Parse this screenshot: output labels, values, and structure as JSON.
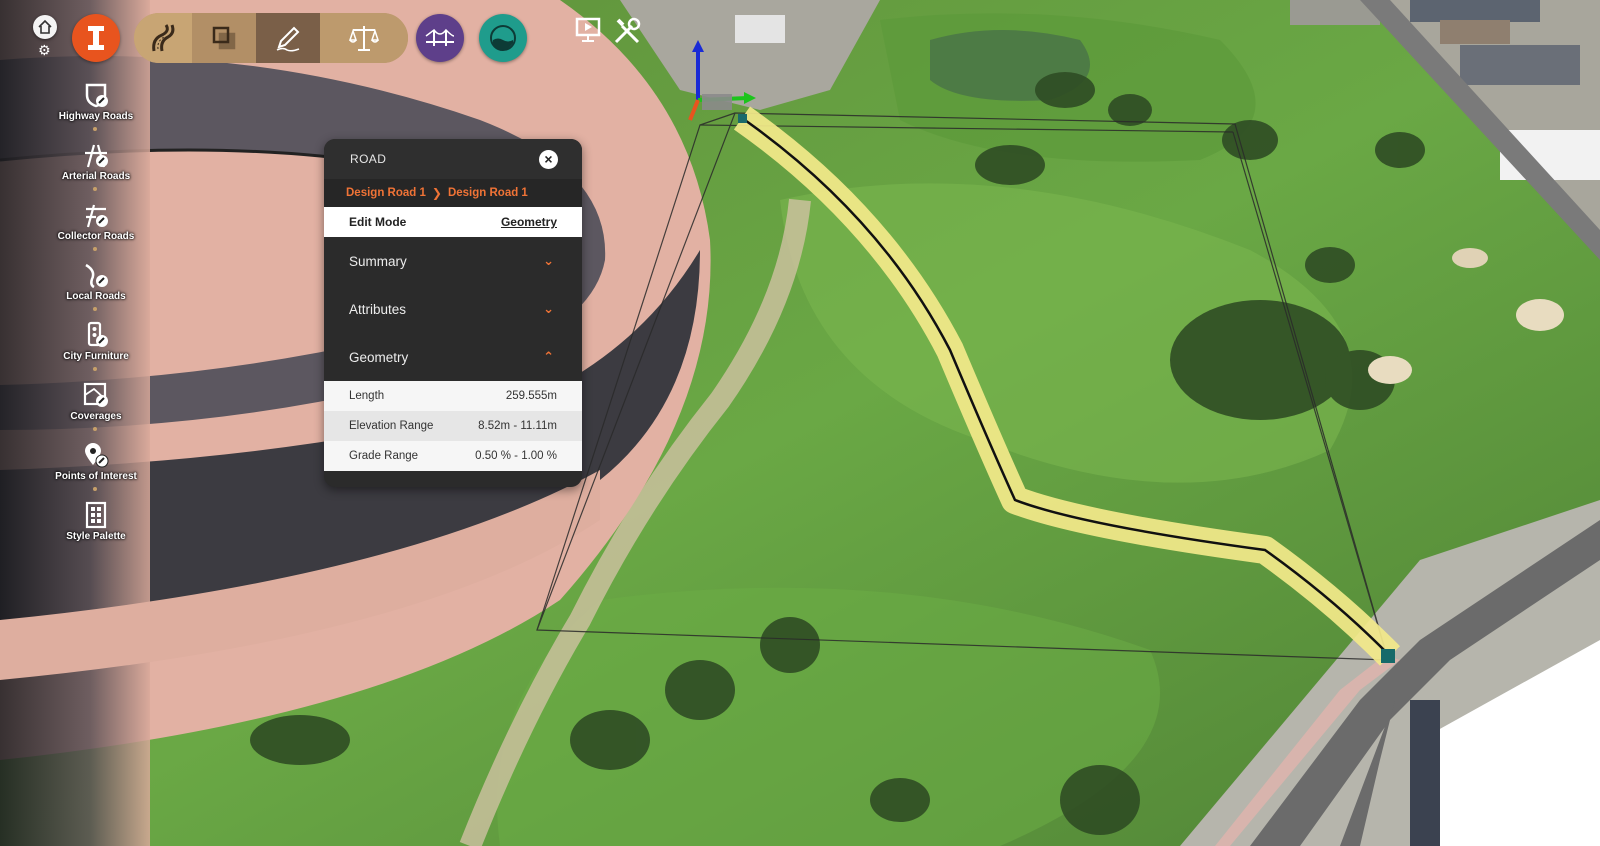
{
  "toolbar": {
    "home_icon": "home-icon",
    "settings_icon": "gear-icon",
    "app_logo": "infraworks-logo",
    "tools": [
      "roads-icon",
      "layers-icon",
      "sketch-pencil-icon",
      "balance-scale-icon"
    ],
    "bridge_icon": "bridge-icon",
    "drainage_icon": "water-drainage-icon",
    "present_icon": "presentation-icon",
    "tools_icon": "wrench-screwdriver-icon",
    "colors": {
      "logo": "#e8541e",
      "tool_group": "#b9956a",
      "tool_active": "#7a5f48",
      "bridge": "#5e3f8a",
      "drainage": "#1f9c8c"
    }
  },
  "sidebar": {
    "items": [
      {
        "label": "Highway Roads",
        "icon": "highway-road-icon"
      },
      {
        "label": "Arterial Roads",
        "icon": "arterial-road-icon"
      },
      {
        "label": "Collector Roads",
        "icon": "collector-road-icon"
      },
      {
        "label": "Local Roads",
        "icon": "local-road-icon"
      },
      {
        "label": "City Furniture",
        "icon": "traffic-light-icon"
      },
      {
        "label": "Coverages",
        "icon": "coverage-icon"
      },
      {
        "label": "Points of Interest",
        "icon": "map-pin-icon"
      },
      {
        "label": "Style Palette",
        "icon": "palette-grid-icon"
      }
    ]
  },
  "panel": {
    "title": "ROAD",
    "close_icon": "close-icon",
    "breadcrumb": [
      "Design Road 1",
      "Design Road 1"
    ],
    "breadcrumb_separator_icon": "chevron-right-icon",
    "edit_mode_label": "Edit Mode",
    "edit_mode_value": "Geometry",
    "sections": [
      {
        "label": "Summary",
        "state": "collapsed"
      },
      {
        "label": "Attributes",
        "state": "collapsed"
      },
      {
        "label": "Geometry",
        "state": "expanded"
      }
    ],
    "geometry_rows": [
      {
        "label": "Length",
        "value": "259.555m"
      },
      {
        "label": "Elevation Range",
        "value": "8.52m - 11.11m"
      },
      {
        "label": "Grade Range",
        "value": "0.50 % - 1.00 %"
      }
    ],
    "accent_color": "#f07336"
  }
}
